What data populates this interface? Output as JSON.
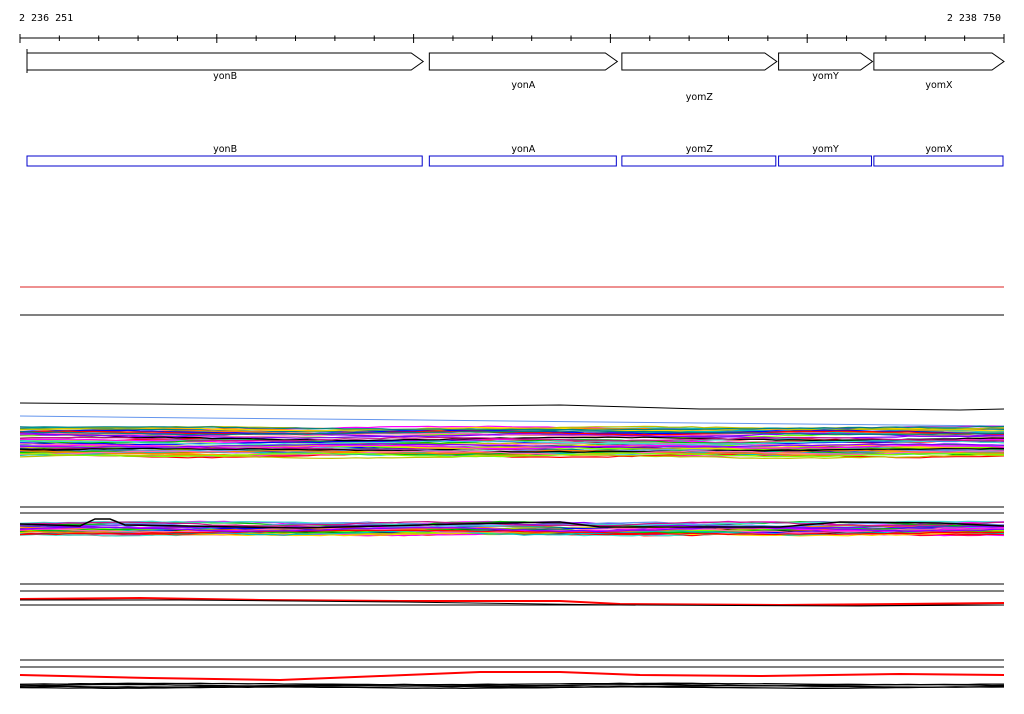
{
  "coordinates": {
    "start": "2 236 251",
    "end": "2 238 750"
  },
  "genes": [
    {
      "name": "yonB",
      "start": 2236251,
      "end": 2237275
    },
    {
      "name": "yonA",
      "start": 2237288,
      "end": 2237768
    },
    {
      "name": "yomZ",
      "start": 2237777,
      "end": 2238173
    },
    {
      "name": "yomY",
      "start": 2238175,
      "end": 2238416
    },
    {
      "name": "yomX",
      "start": 2238417,
      "end": 2238750
    }
  ],
  "colors": {
    "gene_arrow_stroke": "#000000",
    "gene_box_stroke": "#0000cc",
    "gene_box_label": "#000000",
    "threshold_line": "#dd2222",
    "track_line": "#000000",
    "highlight_series": "#ff0000"
  },
  "expression_palette": [
    "#ff00ff",
    "#00c000",
    "#0000ff",
    "#ff0000",
    "#00c0c0",
    "#c0c000",
    "#8000ff",
    "#ff8000",
    "#008080",
    "#000000",
    "#ff69b4",
    "#7fff00",
    "#40e0d0",
    "#c71585",
    "#6495ed",
    "#ffd700"
  ]
}
